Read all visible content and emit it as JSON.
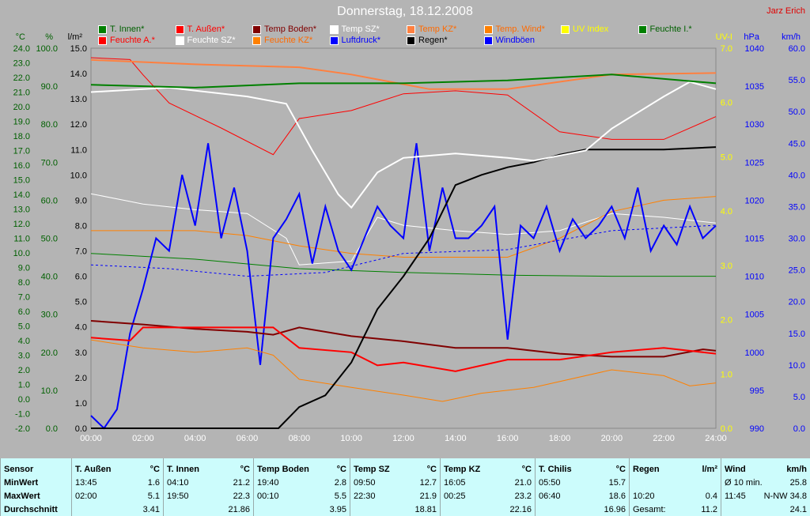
{
  "header": {
    "title": "Donnerstag, 18.12.2008",
    "author": "Jarz Erich"
  },
  "legend": [
    {
      "label": "T. Innen*",
      "color": "#008000"
    },
    {
      "label": "T. Außen*",
      "color": "#ff0000"
    },
    {
      "label": "Temp Boden*",
      "color": "#800000"
    },
    {
      "label": "Temp SZ*",
      "color": "#ffffff"
    },
    {
      "label": "Temp KZ*",
      "color": "#ff8040"
    },
    {
      "label": "Temp. Wind*",
      "color": "#ff8000"
    },
    {
      "label": "UV Index",
      "color": "#ffff00"
    },
    {
      "label": "Feuchte I.*",
      "color": "#008000"
    },
    {
      "label": "Feuchte A.*",
      "color": "#ff0000"
    },
    {
      "label": "Feuchte SZ*",
      "color": "#ffffff"
    },
    {
      "label": "Feuchte KZ*",
      "color": "#ff8000"
    },
    {
      "label": "Luftdruck*",
      "color": "#0000ff"
    },
    {
      "label": "Regen*",
      "color": "#000000"
    },
    {
      "label": "Windböen",
      "color": "#0000ff"
    }
  ],
  "chart_data": {
    "type": "line",
    "title": "Donnerstag, 18.12.2008",
    "x_range": [
      0,
      24
    ],
    "x_ticks": [
      "00:00",
      "02:00",
      "04:00",
      "06:00",
      "08:00",
      "10:00",
      "12:00",
      "14:00",
      "16:00",
      "18:00",
      "20:00",
      "22:00",
      "24:00"
    ],
    "axes": {
      "celsius": {
        "label": "°C",
        "range": [
          -2,
          24
        ],
        "step": 1,
        "color": "#008000"
      },
      "percent": {
        "label": "%",
        "range": [
          0,
          100
        ],
        "step": 10,
        "color": "#008000"
      },
      "rain": {
        "label": "l/m²",
        "range": [
          0,
          15
        ],
        "step": 1,
        "color": "#000000"
      },
      "uv": {
        "label": "UV-I",
        "range": [
          0,
          7
        ],
        "step": 1,
        "color": "#ffff00"
      },
      "hpa": {
        "label": "hPa",
        "range": [
          990,
          1040
        ],
        "step": 5,
        "color": "#0000ff"
      },
      "kmh": {
        "label": "km/h",
        "range": [
          0,
          60
        ],
        "step": 5,
        "color": "#0000ff"
      }
    },
    "series": [
      {
        "name": "Feuchte SZ",
        "axis": "percent",
        "color": "#ffffff",
        "width": 1,
        "points": [
          [
            0,
            61.7
          ],
          [
            2,
            59
          ],
          [
            4,
            57.5
          ],
          [
            6,
            56.5
          ],
          [
            7.5,
            50
          ],
          [
            8,
            43
          ],
          [
            10,
            44
          ],
          [
            11,
            55.5
          ],
          [
            12,
            53.4
          ],
          [
            14,
            52
          ],
          [
            16,
            51
          ],
          [
            18,
            52
          ],
          [
            20,
            56.5
          ],
          [
            22,
            55.5
          ],
          [
            24,
            54
          ]
        ]
      },
      {
        "name": "Feuchte KZ",
        "axis": "percent",
        "color": "#ff8000",
        "width": 1,
        "points": [
          [
            0,
            52
          ],
          [
            2,
            52
          ],
          [
            4,
            52
          ],
          [
            6,
            50.7
          ],
          [
            8,
            48
          ],
          [
            10,
            46
          ],
          [
            12,
            45
          ],
          [
            14,
            45
          ],
          [
            16,
            45
          ],
          [
            18,
            50
          ],
          [
            20,
            57
          ],
          [
            22,
            60
          ],
          [
            24,
            61
          ]
        ]
      },
      {
        "name": "Feuchte I.",
        "axis": "percent",
        "color": "#008000",
        "width": 1,
        "points": [
          [
            0,
            46
          ],
          [
            4,
            44.5
          ],
          [
            8,
            42
          ],
          [
            12,
            41
          ],
          [
            16,
            40.3
          ],
          [
            20,
            40
          ],
          [
            24,
            40
          ]
        ]
      },
      {
        "name": "Feuchte A.",
        "axis": "percent",
        "color": "#ff0000",
        "width": 1,
        "points": [
          [
            0,
            97.5
          ],
          [
            1.5,
            97
          ],
          [
            2,
            93
          ],
          [
            3,
            85.6
          ],
          [
            5,
            79
          ],
          [
            7,
            72
          ],
          [
            8,
            81.5
          ],
          [
            10,
            83.6
          ],
          [
            12,
            88
          ],
          [
            14,
            88.8
          ],
          [
            16,
            87.7
          ],
          [
            18,
            78
          ],
          [
            20,
            76
          ],
          [
            22,
            76
          ],
          [
            24,
            82
          ]
        ]
      },
      {
        "name": "Luftdruck",
        "axis": "hpa",
        "color": "#0000ff",
        "width": 1,
        "dash": "3,3",
        "points": [
          [
            0,
            1011.5
          ],
          [
            3,
            1011
          ],
          [
            6,
            1010
          ],
          [
            9,
            1010.5
          ],
          [
            12,
            1013
          ],
          [
            16,
            1013.5
          ],
          [
            20,
            1016
          ],
          [
            24,
            1016.7
          ]
        ]
      },
      {
        "name": "Windböen",
        "axis": "kmh",
        "color": "#0000ff",
        "width": 2,
        "points": [
          [
            0,
            2
          ],
          [
            0.5,
            0
          ],
          [
            1,
            3
          ],
          [
            1.5,
            15
          ],
          [
            2,
            22
          ],
          [
            2.5,
            30
          ],
          [
            3,
            28
          ],
          [
            3.5,
            40
          ],
          [
            4,
            32
          ],
          [
            4.5,
            45
          ],
          [
            5,
            30
          ],
          [
            5.5,
            38
          ],
          [
            6,
            28
          ],
          [
            6.5,
            10
          ],
          [
            7,
            30
          ],
          [
            7.5,
            33
          ],
          [
            8,
            37
          ],
          [
            8.5,
            26
          ],
          [
            9,
            35
          ],
          [
            9.5,
            28
          ],
          [
            10,
            25
          ],
          [
            10.5,
            30
          ],
          [
            11,
            35
          ],
          [
            11.5,
            32
          ],
          [
            12,
            30
          ],
          [
            12.5,
            45
          ],
          [
            13,
            28
          ],
          [
            13.5,
            38
          ],
          [
            14,
            30
          ],
          [
            14.5,
            30
          ],
          [
            15,
            32
          ],
          [
            15.5,
            35
          ],
          [
            16,
            14
          ],
          [
            16.5,
            32
          ],
          [
            17,
            30
          ],
          [
            17.5,
            35
          ],
          [
            18,
            28
          ],
          [
            18.5,
            33
          ],
          [
            19,
            30
          ],
          [
            19.5,
            32
          ],
          [
            20,
            35
          ],
          [
            20.5,
            30
          ],
          [
            21,
            38
          ],
          [
            21.5,
            28
          ],
          [
            22,
            32
          ],
          [
            22.5,
            29
          ],
          [
            23,
            35
          ],
          [
            23.5,
            30
          ],
          [
            24,
            32
          ]
        ]
      },
      {
        "name": "Temp Wind",
        "axis": "celsius",
        "color": "#ff8000",
        "width": 1,
        "points": [
          [
            0,
            4.05
          ],
          [
            2,
            3.5
          ],
          [
            4,
            3.2
          ],
          [
            6,
            3.5
          ],
          [
            7,
            3
          ],
          [
            8,
            1.35
          ],
          [
            10,
            0.8
          ],
          [
            12,
            0.27
          ],
          [
            13.5,
            -0.16
          ],
          [
            15,
            0.4
          ],
          [
            17,
            0.8
          ],
          [
            20,
            2
          ],
          [
            22,
            1.6
          ],
          [
            23,
            0.9
          ],
          [
            24,
            1.1
          ]
        ]
      },
      {
        "name": "Temp Boden",
        "axis": "celsius",
        "color": "#800000",
        "width": 2,
        "points": [
          [
            0,
            5.35
          ],
          [
            2,
            5.1
          ],
          [
            4,
            4.8
          ],
          [
            6,
            4.6
          ],
          [
            7,
            4.4
          ],
          [
            8,
            4.9
          ],
          [
            10,
            4.3
          ],
          [
            12,
            3.95
          ],
          [
            14,
            3.5
          ],
          [
            16,
            3.5
          ],
          [
            18,
            3.1
          ],
          [
            20,
            2.9
          ],
          [
            22,
            2.9
          ],
          [
            23.5,
            3.4
          ],
          [
            24,
            3.3
          ]
        ]
      },
      {
        "name": "T. Außen",
        "axis": "celsius",
        "color": "#ff0000",
        "width": 2,
        "points": [
          [
            0,
            4.2
          ],
          [
            1.5,
            4
          ],
          [
            2,
            4.9
          ],
          [
            4,
            4.9
          ],
          [
            6,
            4.9
          ],
          [
            7,
            4.9
          ],
          [
            8,
            3.5
          ],
          [
            10,
            3.2
          ],
          [
            11,
            2.3
          ],
          [
            12,
            2.5
          ],
          [
            14,
            1.9
          ],
          [
            16,
            2.7
          ],
          [
            18,
            2.7
          ],
          [
            20,
            3.2
          ],
          [
            22,
            3.5
          ],
          [
            24,
            3.1
          ]
        ]
      },
      {
        "name": "Regen",
        "axis": "rain",
        "color": "#000000",
        "width": 2,
        "points": [
          [
            0,
            0
          ],
          [
            7.2,
            0
          ],
          [
            8,
            0.84
          ],
          [
            9,
            1.3
          ],
          [
            10,
            2.6
          ],
          [
            11,
            4.7
          ],
          [
            12,
            6
          ],
          [
            13,
            7.5
          ],
          [
            14,
            9.6
          ],
          [
            15,
            10
          ],
          [
            16,
            10.3
          ],
          [
            17,
            10.5
          ],
          [
            18,
            10.8
          ],
          [
            19,
            11
          ],
          [
            22,
            11
          ],
          [
            24,
            11.1
          ]
        ]
      },
      {
        "name": "Temp SZ",
        "axis": "celsius",
        "color": "#ffffff",
        "width": 2,
        "points": [
          [
            0,
            21
          ],
          [
            3,
            21.3
          ],
          [
            6,
            20.7
          ],
          [
            7.5,
            20.2
          ],
          [
            8.5,
            17
          ],
          [
            9.5,
            14
          ],
          [
            10,
            13.1
          ],
          [
            11,
            15.5
          ],
          [
            12,
            16.5
          ],
          [
            14,
            16.8
          ],
          [
            16,
            16.5
          ],
          [
            17,
            16.3
          ],
          [
            19,
            17
          ],
          [
            20,
            18.5
          ],
          [
            22,
            20.7
          ],
          [
            23,
            21.7
          ],
          [
            24,
            21.2
          ]
        ]
      },
      {
        "name": "Temp KZ",
        "axis": "celsius",
        "color": "#ff8040",
        "width": 2,
        "points": [
          [
            0,
            23.2
          ],
          [
            4,
            22.9
          ],
          [
            8,
            22.7
          ],
          [
            10,
            22.2
          ],
          [
            13,
            21.2
          ],
          [
            16,
            21.2
          ],
          [
            20,
            22.2
          ],
          [
            24,
            22.3
          ]
        ]
      },
      {
        "name": "T. Innen",
        "axis": "celsius",
        "color": "#008000",
        "width": 2,
        "points": [
          [
            0,
            21.5
          ],
          [
            4,
            21.3
          ],
          [
            8,
            21.6
          ],
          [
            12,
            21.6
          ],
          [
            16,
            21.8
          ],
          [
            20,
            22.2
          ],
          [
            24,
            21.6
          ]
        ]
      }
    ]
  },
  "table": {
    "columns": [
      {
        "name": "Sensor",
        "unit": "",
        "rows": [
          [
            "MinWert",
            ""
          ],
          [
            "MaxWert",
            ""
          ],
          [
            "Durchschnitt",
            ""
          ]
        ]
      },
      {
        "name": "T. Außen",
        "unit": "°C",
        "rows": [
          [
            "13:45",
            "1.6"
          ],
          [
            "02:00",
            "5.1"
          ],
          [
            "",
            "3.41"
          ]
        ]
      },
      {
        "name": "T. Innen",
        "unit": "°C",
        "rows": [
          [
            "04:10",
            "21.2"
          ],
          [
            "19:50",
            "22.3"
          ],
          [
            "",
            "21.86"
          ]
        ]
      },
      {
        "name": "Temp Boden",
        "unit": "°C",
        "rows": [
          [
            "19:40",
            "2.8"
          ],
          [
            "00:10",
            "5.5"
          ],
          [
            "",
            "3.95"
          ]
        ]
      },
      {
        "name": "Temp SZ",
        "unit": "°C",
        "rows": [
          [
            "09:50",
            "12.7"
          ],
          [
            "22:30",
            "21.9"
          ],
          [
            "",
            "18.81"
          ]
        ]
      },
      {
        "name": "Temp KZ",
        "unit": "°C",
        "rows": [
          [
            "16:05",
            "21.0"
          ],
          [
            "00:25",
            "23.2"
          ],
          [
            "",
            "22.16"
          ]
        ]
      },
      {
        "name": "T. Chilis",
        "unit": "°C",
        "rows": [
          [
            "05:50",
            "15.7"
          ],
          [
            "06:40",
            "18.6"
          ],
          [
            "",
            "16.96"
          ]
        ]
      },
      {
        "name": "Regen",
        "unit": "l/m²",
        "rows": [
          [
            "",
            ""
          ],
          [
            "10:20",
            "0.4"
          ],
          [
            "Gesamt:",
            "11.2"
          ]
        ]
      },
      {
        "name": "Wind",
        "unit": "km/h",
        "rows": [
          [
            "Ø 10 min.",
            "25.8"
          ],
          [
            "11:45",
            "N-NW 34.8"
          ],
          [
            "",
            "24.1"
          ]
        ]
      }
    ]
  }
}
